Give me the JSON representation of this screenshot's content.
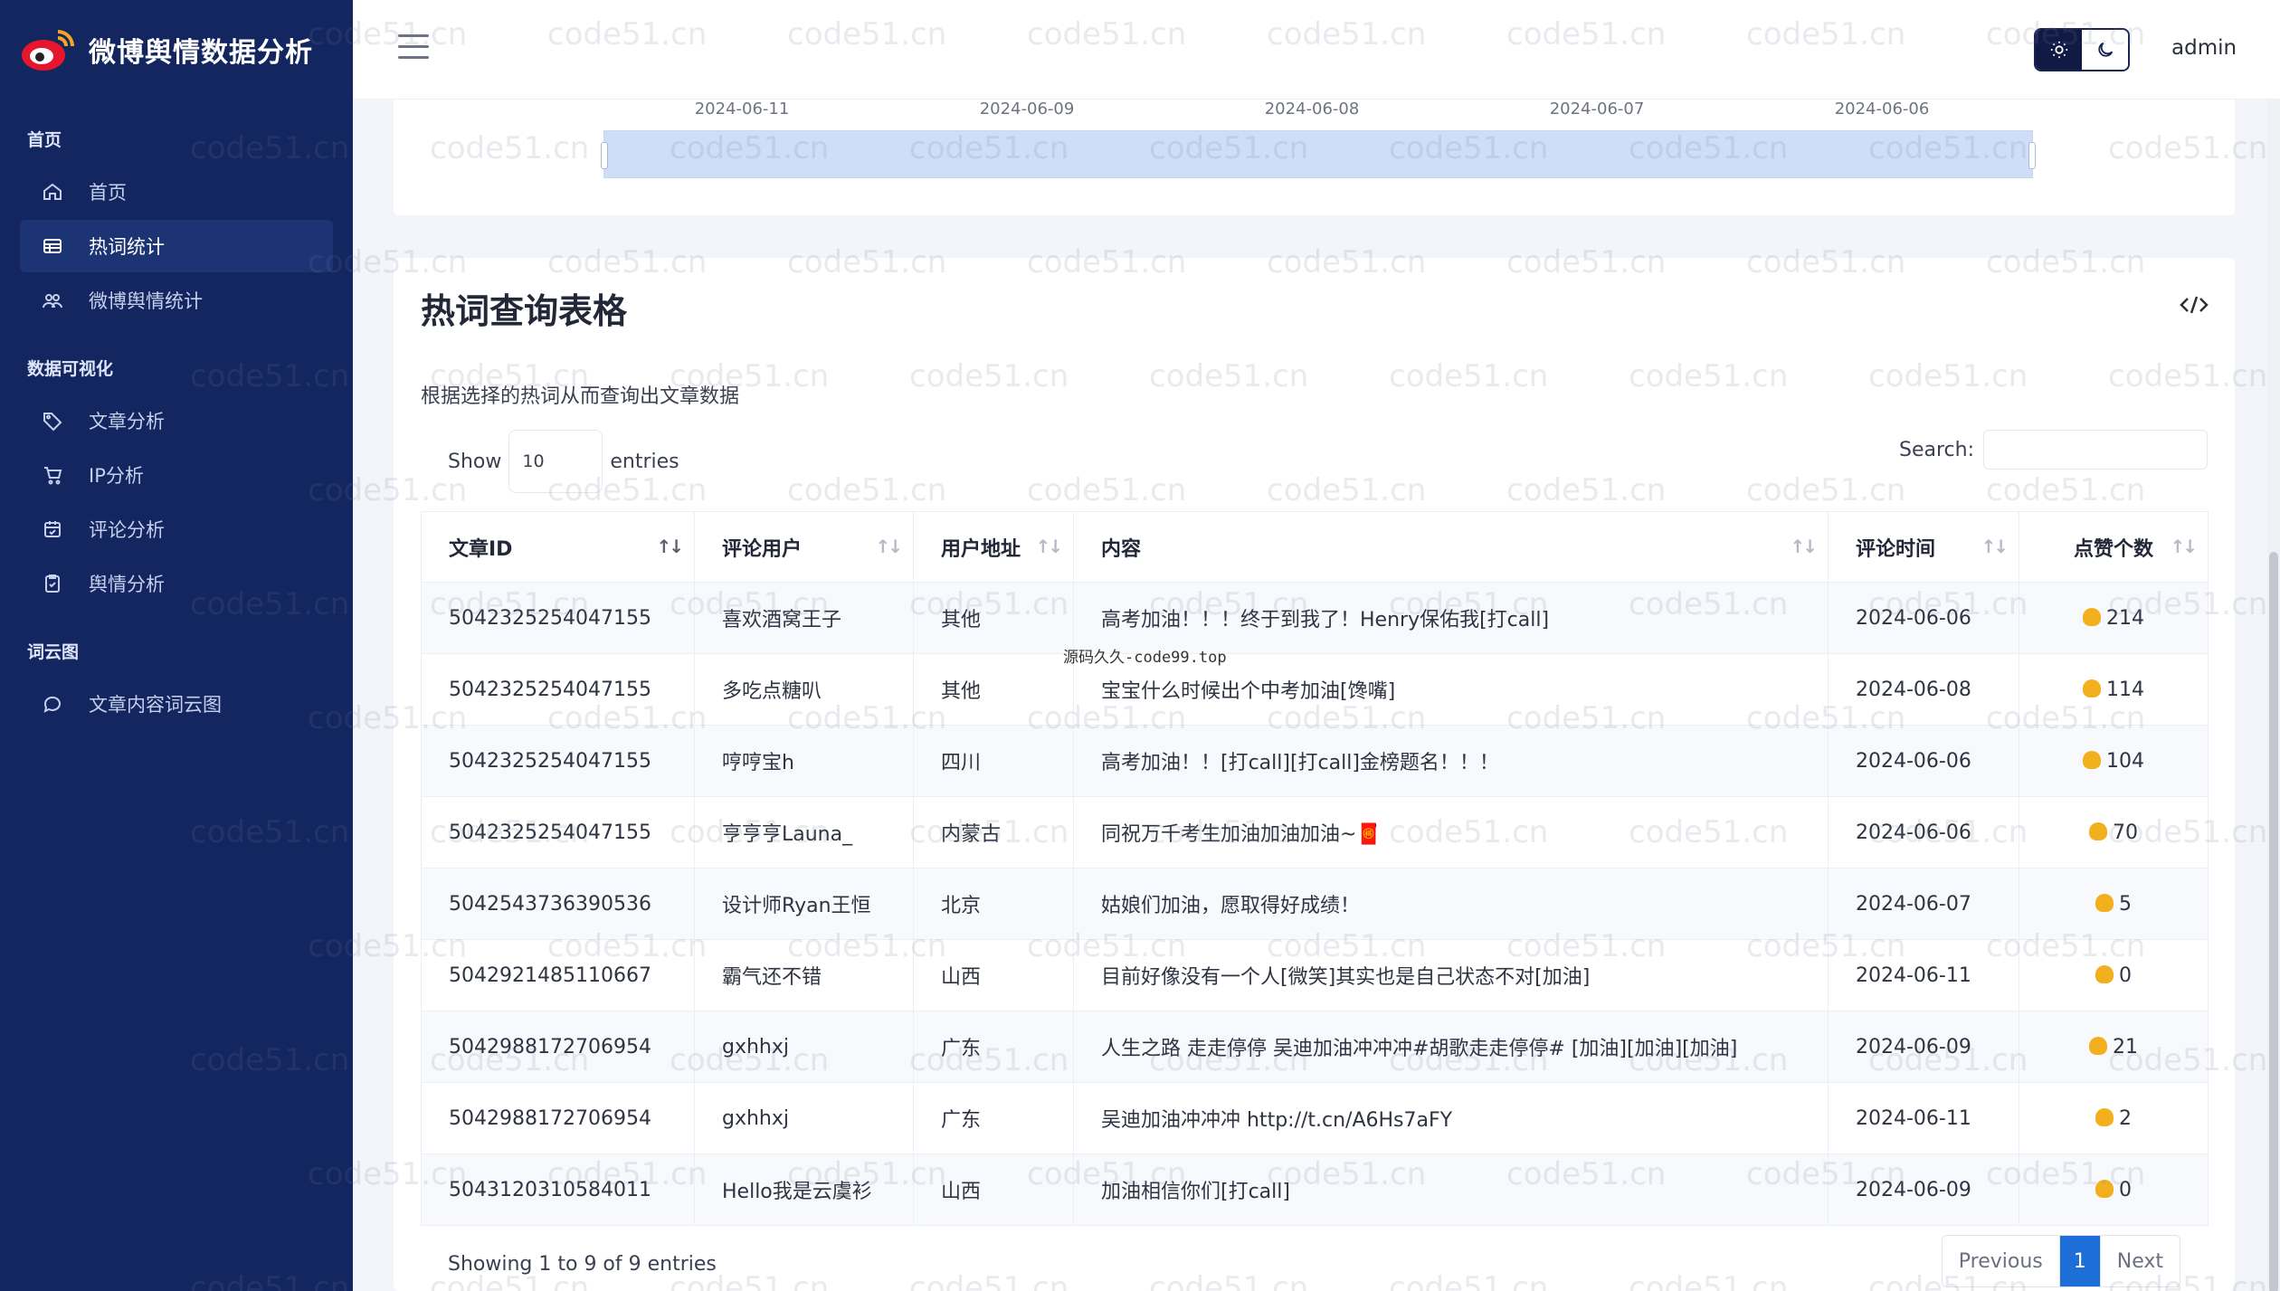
{
  "app": {
    "title": "微博舆情数据分析",
    "user": "admin"
  },
  "sidebar": {
    "sections": [
      {
        "label": "首页",
        "items": [
          {
            "label": "首页",
            "icon": "home-icon",
            "active": false
          },
          {
            "label": "热词统计",
            "icon": "table-icon",
            "active": true
          },
          {
            "label": "微博舆情统计",
            "icon": "users-icon",
            "active": false
          }
        ]
      },
      {
        "label": "数据可视化",
        "items": [
          {
            "label": "文章分析",
            "icon": "tag-icon",
            "active": false
          },
          {
            "label": "IP分析",
            "icon": "cart-icon",
            "active": false
          },
          {
            "label": "评论分析",
            "icon": "calendar-icon",
            "active": false
          },
          {
            "label": "舆情分析",
            "icon": "clipboard-icon",
            "active": false
          }
        ]
      },
      {
        "label": "词云图",
        "items": [
          {
            "label": "文章内容词云图",
            "icon": "chat-icon",
            "active": false
          }
        ]
      }
    ]
  },
  "datazoom": {
    "labels": [
      "2024-06-11",
      "2024-06-09",
      "2024-06-08",
      "2024-06-07",
      "2024-06-06"
    ]
  },
  "card": {
    "title": "热词查询表格",
    "description": "根据选择的热词从而查询出文章数据",
    "show_label": "Show",
    "page_length": "10",
    "entries_label": "entries",
    "search_label": "Search:",
    "search_value": ""
  },
  "table": {
    "headers": [
      "文章ID",
      "评论用户",
      "用户地址",
      "内容",
      "评论时间",
      "点赞个数"
    ],
    "rows": [
      [
        "5042325254047155",
        "喜欢酒窝王子",
        "其他",
        "高考加油！！！终于到我了！Henry保佑我[打call]",
        "2024-06-06",
        "214"
      ],
      [
        "5042325254047155",
        "多吃点糖叭",
        "其他",
        "宝宝什么时候出个中考加油[馋嘴]",
        "2024-06-08",
        "114"
      ],
      [
        "5042325254047155",
        "哼哼宝h",
        "四川",
        "高考加油！！[打call][打call]金榜题名！！！",
        "2024-06-06",
        "104"
      ],
      [
        "5042325254047155",
        "亨亨亨Launa_",
        "内蒙古",
        "同祝万千考生加油加油加油~🧧",
        "2024-06-06",
        "70"
      ],
      [
        "5042543736390536",
        "设计师Ryan王恒",
        "北京",
        "姑娘们加油，愿取得好成绩！",
        "2024-06-07",
        "5"
      ],
      [
        "5042921485110667",
        "霸气还不错",
        "山西",
        "目前好像没有一个人[微笑]其实也是自己状态不对[加油]",
        "2024-06-11",
        "0"
      ],
      [
        "5042988172706954",
        "gxhhxj",
        "广东",
        "人生之路 走走停停 吴迪加油冲冲冲#胡歌走走停停# [加油][加油][加油]",
        "2024-06-09",
        "21"
      ],
      [
        "5042988172706954",
        "gxhhxj",
        "广东",
        "吴迪加油冲冲冲 http://t.cn/A6Hs7aFY",
        "2024-06-11",
        "2"
      ],
      [
        "5043120310584011",
        "Hello我是云虞衫",
        "山西",
        "加油相信你们[打call]",
        "2024-06-09",
        "0"
      ]
    ]
  },
  "footer": {
    "info": "Showing 1 to 9 of 9 entries",
    "prev": "Previous",
    "current_page": "1",
    "next": "Next"
  },
  "overlay_note": "源码久久-code99.top",
  "watermark": "code51.cn",
  "colors": {
    "sidebar": "#132660",
    "accent": "#1e6ed8",
    "active_item": "#1d3474"
  }
}
